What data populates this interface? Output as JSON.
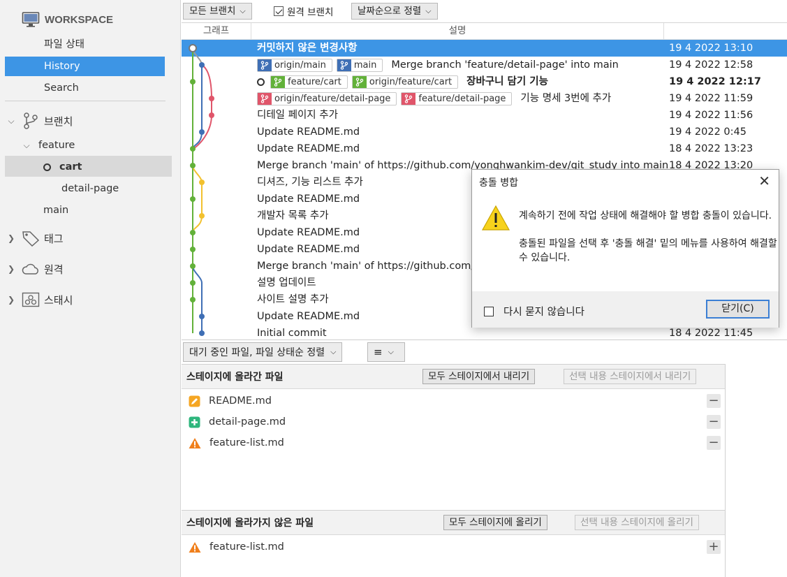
{
  "sidebar": {
    "workspace_title": "WORKSPACE",
    "workspace_items": [
      "파일 상태",
      "History",
      "Search"
    ],
    "active_item": "History",
    "branches_label": "브랜치",
    "branch_folder": "feature",
    "branch_cart": "cart",
    "branch_detail": "detail-page",
    "branch_main": "main",
    "tags_label": "태그",
    "remotes_label": "원격",
    "stash_label": "스태시"
  },
  "toolbar": {
    "branch_filter": "모든 브랜치",
    "remote_branch_label": "원격 브랜치",
    "remote_branch_checked": true,
    "sort_order": "날짜순으로 정렬"
  },
  "history": {
    "col_graph": "그래프",
    "col_desc": "설명",
    "rows": [
      {
        "desc": "커밋하지 않은 변경사항",
        "date": "19 4 2022 13:10",
        "tags": [],
        "selected": true
      },
      {
        "desc": "Merge branch 'feature/detail-page' into main",
        "date": "19 4 2022 12:58",
        "tags": [
          {
            "label": "origin/main",
            "color": "blue"
          },
          {
            "label": "main",
            "color": "blue"
          }
        ]
      },
      {
        "desc": "장바구니 담기 기능",
        "date": "19 4 2022 12:17",
        "tags": [
          {
            "label": "feature/cart",
            "color": "green"
          },
          {
            "label": "origin/feature/cart",
            "color": "green"
          }
        ],
        "bold": true,
        "current": true
      },
      {
        "desc": "기능 명세 3번에 추가",
        "date": "19 4 2022 11:59",
        "tags": [
          {
            "label": "origin/feature/detail-page",
            "color": "red"
          },
          {
            "label": "feature/detail-page",
            "color": "red"
          }
        ]
      },
      {
        "desc": "디테일 페이지 추가",
        "date": "19 4 2022 11:56",
        "tags": []
      },
      {
        "desc": "Update README.md",
        "date": "19 4 2022 0:45",
        "tags": []
      },
      {
        "desc": "Update README.md",
        "date": "18 4 2022 13:23",
        "tags": []
      },
      {
        "desc": "Merge branch 'main' of https://github.com/yonghwankim-dev/git_study into main",
        "date": "18 4 2022 13:20",
        "tags": []
      },
      {
        "desc": "디셔즈, 기능 리스트 추가",
        "date": "",
        "tags": []
      },
      {
        "desc": "Update README.md",
        "date": "",
        "tags": []
      },
      {
        "desc": "개발자 목록 추가",
        "date": "",
        "tags": []
      },
      {
        "desc": "Update README.md",
        "date": "",
        "tags": []
      },
      {
        "desc": "Update README.md",
        "date": "",
        "tags": []
      },
      {
        "desc": "Merge branch 'main' of https://github.com/yo",
        "date": "",
        "tags": []
      },
      {
        "desc": "설명 업데이트",
        "date": "",
        "tags": []
      },
      {
        "desc": "사이트 설명 추가",
        "date": "",
        "tags": []
      },
      {
        "desc": "Update README.md",
        "date": "",
        "tags": []
      },
      {
        "desc": "Initial commit",
        "date": "18 4 2022 11:45",
        "tags": []
      }
    ]
  },
  "file_bar": {
    "sort_label": "대기 중인 파일, 파일 상태순 정렬",
    "view_icon": "list-icon"
  },
  "staged": {
    "title": "스테이지에 올라간 파일",
    "unstage_all": "모두 스테이지에서 내리기",
    "unstage_selected": "선택 내용 스테이지에서 내리기",
    "files": [
      {
        "name": "README.md",
        "status": "modified"
      },
      {
        "name": "detail-page.md",
        "status": "added"
      },
      {
        "name": "feature-list.md",
        "status": "conflict"
      }
    ]
  },
  "unstaged": {
    "title": "스테이지에 올라가지 않은 파일",
    "stage_all": "모두 스테이지에 올리기",
    "stage_selected": "선택 내용 스테이지에 올리기",
    "files": [
      {
        "name": "feature-list.md",
        "status": "conflict"
      }
    ]
  },
  "dialog": {
    "title": "충돌 병합",
    "message_1": "계속하기 전에 작업 상태에 해결해야 할 병합 충돌이 있습니다.",
    "message_2": "충돌된 파일을 선택 후 '충돌 해결' 밑의 메뉴를 사용하여 해결할 수 있습니다.",
    "dont_ask": "다시 묻지 않습니다",
    "close_button": "닫기(C)"
  },
  "colors": {
    "accent": "#3d95e5",
    "graph_green": "#62b139",
    "graph_blue": "#3f6fb5",
    "graph_red": "#e0556a",
    "graph_yellow": "#f2c12e",
    "modified": "#f5a623",
    "added": "#2eb67d",
    "conflict": "#f07f1b"
  }
}
